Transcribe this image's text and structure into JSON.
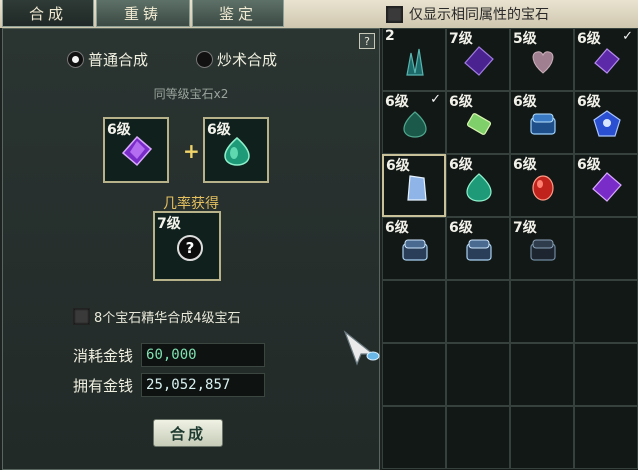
{
  "tabs": [
    "合成",
    "重铸",
    "鉴定"
  ],
  "filter_label": "仅显示相同属性的宝石",
  "help_label": "?",
  "modes": [
    {
      "label": "普通合成",
      "selected": true
    },
    {
      "label": "炒术合成",
      "selected": false
    }
  ],
  "hint": "同等级宝石x2",
  "inputs": [
    {
      "level": "6级",
      "gem": "purple-gem-icon"
    },
    {
      "level": "6级",
      "gem": "green-gem-icon"
    }
  ],
  "plus": "+",
  "chance_label": "几率获得",
  "result": {
    "level": "7级",
    "symbol": "?"
  },
  "essence_label": "8个宝石精华合成4级宝石",
  "cost": {
    "label": "消耗金钱",
    "value": "60,000"
  },
  "owned": {
    "label": "拥有金钱",
    "value": "25,052,857"
  },
  "compose_button": "合成",
  "grid": [
    {
      "level": "2",
      "gem": "teal-crystal",
      "checked": false,
      "selected": false
    },
    {
      "level": "7级",
      "gem": "purple",
      "checked": false,
      "selected": false
    },
    {
      "level": "5级",
      "gem": "pink-heart",
      "checked": false,
      "selected": false
    },
    {
      "level": "6级",
      "gem": "purple",
      "checked": true,
      "selected": false
    },
    {
      "level": "6级",
      "gem": "teal",
      "checked": true,
      "selected": false
    },
    {
      "level": "6级",
      "gem": "green-bar",
      "checked": false,
      "selected": false
    },
    {
      "level": "6级",
      "gem": "blue-chest",
      "checked": false,
      "selected": false
    },
    {
      "level": "6级",
      "gem": "blue-gem",
      "checked": false,
      "selected": false
    },
    {
      "level": "6级",
      "gem": "ice-crystal",
      "checked": false,
      "selected": true
    },
    {
      "level": "6级",
      "gem": "green",
      "checked": false,
      "selected": false
    },
    {
      "level": "6级",
      "gem": "red",
      "checked": false,
      "selected": false
    },
    {
      "level": "6级",
      "gem": "purple",
      "checked": false,
      "selected": false
    },
    {
      "level": "6级",
      "gem": "ice-chest",
      "checked": false,
      "selected": false
    },
    {
      "level": "6级",
      "gem": "ice-chest",
      "checked": false,
      "selected": false
    },
    {
      "level": "7级",
      "gem": "dark-chest",
      "checked": false,
      "selected": false
    },
    {
      "level": "",
      "gem": "",
      "checked": false,
      "selected": false
    }
  ],
  "colors": {
    "accent_gold": "#e4c060",
    "cost_green": "#7fe0b0"
  }
}
